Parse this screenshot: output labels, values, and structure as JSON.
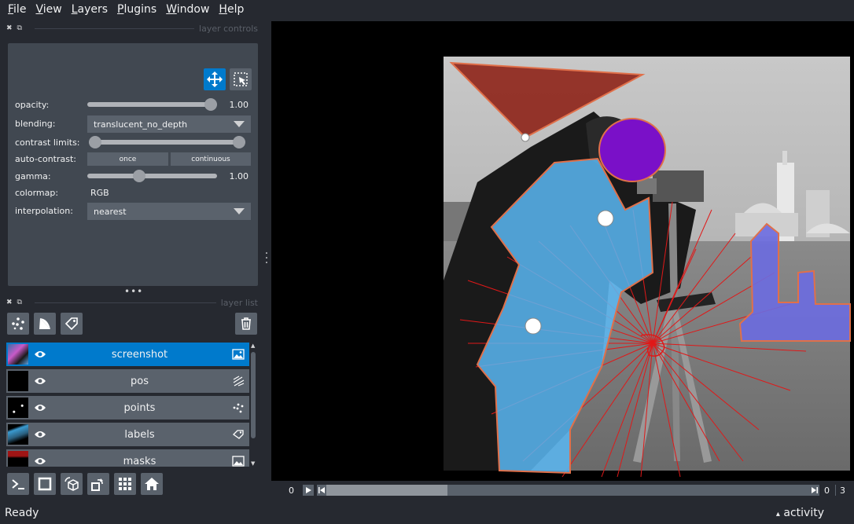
{
  "menu": [
    {
      "label": "File",
      "u": "F",
      "rest": "ile"
    },
    {
      "label": "View",
      "u": "V",
      "rest": "iew"
    },
    {
      "label": "Layers",
      "u": "L",
      "rest": "ayers"
    },
    {
      "label": "Plugins",
      "u": "P",
      "rest": "lugins"
    },
    {
      "label": "Window",
      "u": "W",
      "rest": "indow"
    },
    {
      "label": "Help",
      "u": "H",
      "rest": "elp"
    }
  ],
  "layer_controls": {
    "title": "layer controls",
    "opacity_label": "opacity:",
    "opacity_value": "1.00",
    "opacity_fraction": 1.0,
    "blending_label": "blending:",
    "blending_value": "translucent_no_depth",
    "contrast_label": "contrast limits:",
    "contrast_low_fraction": 0.0,
    "contrast_high_fraction": 1.0,
    "autocontrast_label": "auto-contrast:",
    "once_label": "once",
    "continuous_label": "continuous",
    "gamma_label": "gamma:",
    "gamma_value": "1.00",
    "gamma_fraction": 0.39,
    "colormap_label": "colormap:",
    "colormap_value": "RGB",
    "interpolation_label": "interpolation:",
    "interpolation_value": "nearest"
  },
  "layer_list": {
    "title": "layer list",
    "layers": [
      {
        "name": "screenshot",
        "type_icon": "image-icon",
        "selected": true
      },
      {
        "name": "pos",
        "type_icon": "vectors-icon",
        "selected": false
      },
      {
        "name": "points",
        "type_icon": "points-icon",
        "selected": false
      },
      {
        "name": "labels",
        "type_icon": "labels-icon",
        "selected": false
      },
      {
        "name": "masks",
        "type_icon": "image-icon",
        "selected": false
      }
    ]
  },
  "dims": {
    "current": "0",
    "end": "0",
    "total": "3",
    "slider_fraction": 0.25
  },
  "status": {
    "text": "Ready",
    "activity": "activity",
    "activity_arrow": "▴"
  },
  "colors": {
    "background": "#262930",
    "panel": "#414851",
    "control": "#5a626c",
    "accent": "#007acc"
  }
}
